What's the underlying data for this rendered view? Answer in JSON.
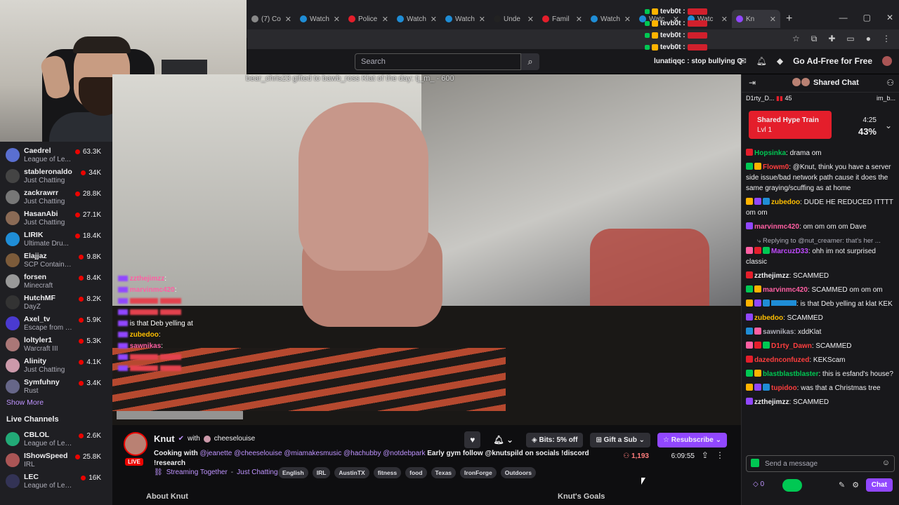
{
  "browser": {
    "tabs": [
      {
        "label": "(7) Co",
        "color": "#888888"
      },
      {
        "label": "Watch",
        "color": "#1f8dd6"
      },
      {
        "label": "Police",
        "color": "#e41e2b"
      },
      {
        "label": "Watch",
        "color": "#1f8dd6"
      },
      {
        "label": "Watch",
        "color": "#1f8dd6"
      },
      {
        "label": "Unde",
        "color": "#222222"
      },
      {
        "label": "Famil",
        "color": "#e41e2b"
      },
      {
        "label": "Watch",
        "color": "#1f8dd6"
      },
      {
        "label": "Watc",
        "color": "#1f8dd6"
      },
      {
        "label": "Watc",
        "color": "#1f8dd6"
      },
      {
        "label": "Kn",
        "color": "#9147ff"
      }
    ]
  },
  "topnav": {
    "search_placeholder": "Search",
    "ad_free": "Go Ad-Free for Free"
  },
  "notifications": {
    "user": "tevb0t :",
    "lunatiqqc": "lunatiqqc : stop bullying Q"
  },
  "sidebar": {
    "channels": [
      {
        "name": "Caedrel",
        "game": "League of Le...",
        "viewers": "63.3K",
        "color": "#5a6fd0"
      },
      {
        "name": "stableronaldo",
        "game": "Just Chatting",
        "viewers": "34K",
        "color": "#444"
      },
      {
        "name": "zackrawrr",
        "game": "Just Chatting",
        "viewers": "28.8K",
        "color": "#777"
      },
      {
        "name": "HasanAbi",
        "game": "Just Chatting",
        "viewers": "27.1K",
        "color": "#8a6a55"
      },
      {
        "name": "LIRIK",
        "game": "Ultimate Dru...",
        "viewers": "18.4K",
        "color": "#1f8dd6"
      },
      {
        "name": "Elajjaz",
        "game": "SCP Containm...",
        "viewers": "9.8K",
        "color": "#7c5b3a"
      },
      {
        "name": "forsen",
        "game": "Minecraft",
        "viewers": "8.4K",
        "color": "#999"
      },
      {
        "name": "HutchMF",
        "game": "DayZ",
        "viewers": "8.2K",
        "color": "#333"
      },
      {
        "name": "Axel_tv",
        "game": "Escape from T...",
        "viewers": "5.9K",
        "color": "#4a3ad0"
      },
      {
        "name": "loltyler1",
        "game": "Warcraft III",
        "viewers": "5.3K",
        "color": "#a77"
      },
      {
        "name": "Alinity",
        "game": "Just Chatting",
        "viewers": "4.1K",
        "color": "#c9a"
      },
      {
        "name": "Symfuhny",
        "game": "Rust",
        "viewers": "3.4K",
        "color": "#668"
      }
    ],
    "show_more": "Show More",
    "live_title": "Live Channels",
    "live_channels": [
      {
        "name": "CBLOL",
        "game": "League of Leg...",
        "viewers": "2.6K",
        "color": "#2a7"
      },
      {
        "name": "IShowSpeed",
        "game": "IRL",
        "viewers": "25.8K",
        "color": "#a55"
      },
      {
        "name": "LEC",
        "game": "League of Lege...",
        "viewers": "16K",
        "color": "#335"
      }
    ]
  },
  "video": {
    "overlay_text": "bear_chris23 gifted to bawb_ross   Klat of the day: tj_m_ - 600",
    "chat": [
      {
        "user": "zzthejimzz",
        "text": ""
      },
      {
        "user": "marvinmc420",
        "text": ""
      },
      {
        "user": "",
        "text": ""
      },
      {
        "user": "",
        "text": ""
      },
      {
        "user": "",
        "text": "is that Deb yelling at"
      },
      {
        "user": "zubedoo",
        "text": ""
      },
      {
        "user": "sawnikas",
        "text": ""
      },
      {
        "user": "",
        "text": ""
      },
      {
        "user": "",
        "text": ""
      }
    ]
  },
  "stream": {
    "name": "Knut",
    "with": "with",
    "collab": "cheeselouise",
    "live": "LIVE",
    "title_pre": "Cooking with ",
    "mentions": "@jeanette @cheeselouise @miamakesmusic @hachubby @notdebpark",
    "title_post": " Early gym  follow @knutspild on socials !discord !research",
    "together": "Streaming Together",
    "category": "Just Chatting",
    "tags": [
      "English",
      "IRL",
      "AustinTX",
      "fitness",
      "food",
      "Texas",
      "IronForge",
      "Outdoors"
    ],
    "bits": "Bits: 5% off",
    "gift": "Gift a Sub",
    "resub": "Resubscribe",
    "viewers": "1,193",
    "uptime": "6:09:55",
    "about": "About Knut",
    "goals": "Knut's Goals"
  },
  "chat": {
    "title": "Shared Chat",
    "leader_left": "D1rty_D...",
    "leader_count": "45",
    "leader_right": "im_b...",
    "hype": {
      "title": "Shared Hype Train",
      "level": "Lvl 1",
      "time": "4:25",
      "percent": "43%"
    },
    "messages": [
      {
        "user": "Hopsinka",
        "color": "#00c853",
        "text": "drama om"
      },
      {
        "user": "Flowm0",
        "color": "#ff3e3e",
        "text": "@Knut, think you have a server side issue/bad network path cause it does the same graying/scuffing as at home"
      },
      {
        "user": "zubedoo",
        "color": "#ffbf00",
        "text": "DUDE HE REDUCED ITTTT om om"
      },
      {
        "user": "marvinmc420",
        "color": "#ff5fa3",
        "text": "om om om om Dave"
      },
      {
        "reply": "Replying to @nut_creamer: that's her ..."
      },
      {
        "user": "MarcuzD33",
        "color": "#c04aff",
        "text": "ohh im not surprised classic"
      },
      {
        "user": "zzthejimzz",
        "color": "#efeff1",
        "text": "SCAMMED"
      },
      {
        "user": "marvinmc420",
        "color": "#ff5fa3",
        "text": "SCAMMED om om om"
      },
      {
        "user": "",
        "color": "#1f8dd6",
        "text": "is that Deb yelling at klat KEK"
      },
      {
        "user": "zubedoo",
        "color": "#ffbf00",
        "text": "SCAMMED"
      },
      {
        "user": "sawnikas",
        "color": "#adadb8",
        "text": "xddKlat"
      },
      {
        "user": "D1rty_Dawn",
        "color": "#ff3e3e",
        "text": "SCAMMED"
      },
      {
        "user": "dazednconfuzed",
        "color": "#ff3e3e",
        "text": "KEKScam"
      },
      {
        "user": "blastblastblaster",
        "color": "#00c853",
        "text": "this is esfand's house?"
      },
      {
        "user": "tupidoo",
        "color": "#ff3e3e",
        "text": "was that a Christmas tree"
      },
      {
        "user": "zzthejimzz",
        "color": "#efeff1",
        "text": "SCAMMED"
      }
    ],
    "input_placeholder": "Send a message",
    "points": "0",
    "send": "Chat"
  }
}
